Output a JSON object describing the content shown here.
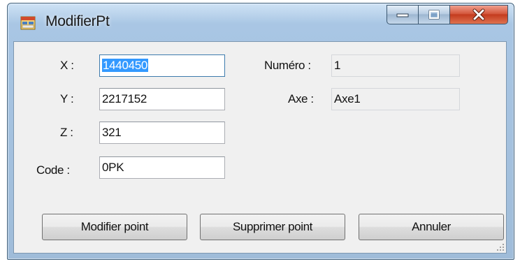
{
  "window": {
    "title": "ModifierPt",
    "minimize_glyph": "minimize-icon",
    "maximize_glyph": "maximize-icon",
    "close_glyph": "close-icon",
    "close_color": "#c43b1e"
  },
  "form": {
    "x_label": "X :",
    "x_value": "1440450",
    "y_label": "Y :",
    "y_value": "2217152",
    "z_label": "Z :",
    "z_value": "321",
    "code_label": "Code :",
    "code_value": "0PK",
    "numero_label": "Numéro :",
    "numero_value": "1",
    "axe_label": "Axe :",
    "axe_value": "Axe1"
  },
  "buttons": {
    "modify": "Modifier point",
    "delete": "Supprimer point",
    "cancel": "Annuler"
  },
  "colors": {
    "selection": "#3399ff",
    "frame": "#a9c6e4",
    "client_bg": "#f0f0f0"
  }
}
